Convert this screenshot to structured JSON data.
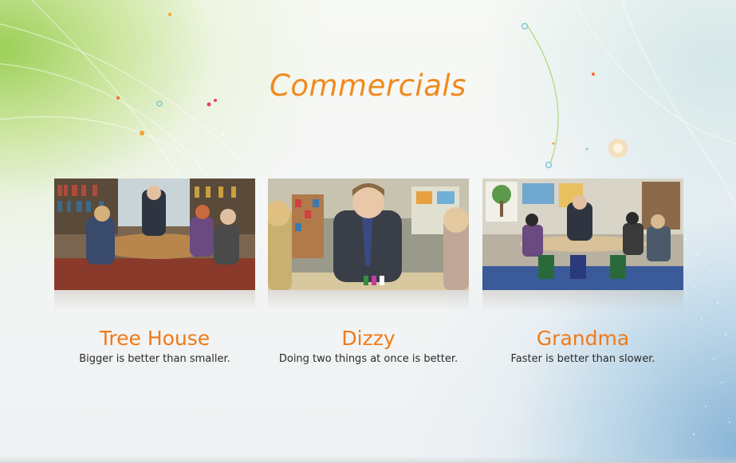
{
  "page": {
    "title": "Commercials"
  },
  "commercials": [
    {
      "title": "Tree House",
      "caption": "Bigger is better than smaller.",
      "scene": "library-table-scene"
    },
    {
      "title": "Dizzy",
      "caption": "Doing two things at once is better.",
      "scene": "classroom-closeup-scene"
    },
    {
      "title": "Grandma",
      "caption": "Faster is better than slower.",
      "scene": "classroom-wide-scene"
    }
  ],
  "colors": {
    "accent": "#f08a1e",
    "caption_text": "#2a2a2a",
    "background_green": "#8cc83c",
    "background_blue": "#78aad2"
  }
}
